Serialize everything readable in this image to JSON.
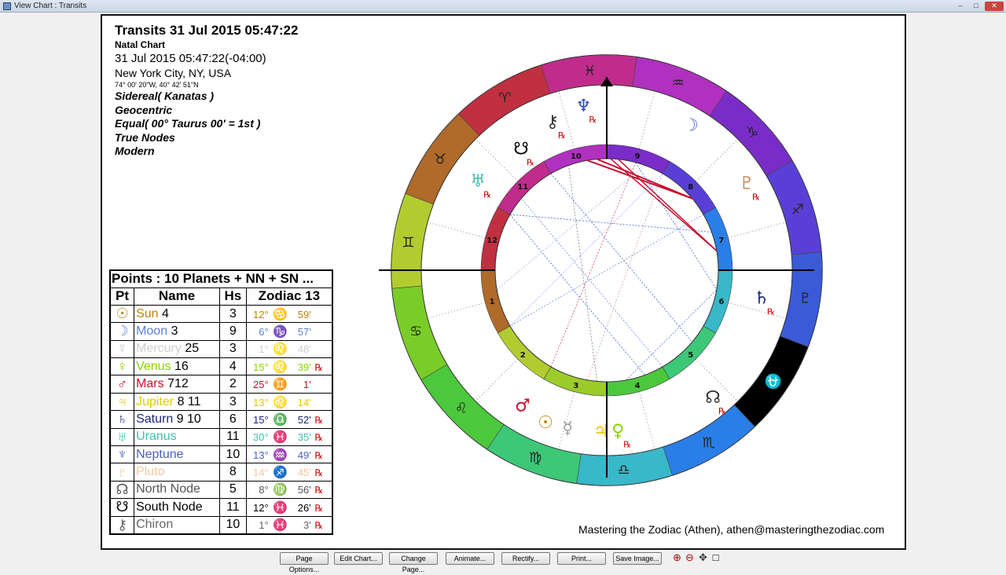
{
  "window": {
    "title": "View Chart : Transits",
    "min": "–",
    "max": "□",
    "close": "✕"
  },
  "header": {
    "title": "Transits 31 Jul 2015 05:47:22",
    "subtitle": "Natal Chart",
    "datetime": "31 Jul 2015 05:47:22(-04:00)",
    "location": "New York City, NY, USA",
    "coords": "74° 00' 20\"W, 40° 42' 51\"N",
    "zodiac": "Sidereal( Kanatas )",
    "centric": "Geocentric",
    "houses": "Equal( 00° Taurus 00' = 1st )",
    "nodes": "True Nodes",
    "style": "Modern"
  },
  "table": {
    "caption": "Points : 10 Planets + NN + SN ...",
    "headers": [
      "Pt",
      "Name",
      "Hs",
      "Zodiac 13"
    ],
    "rows": [
      {
        "glyph": "☉",
        "color": "#b8860b",
        "name": "Sun",
        "extra": "4",
        "house": "3",
        "deg": "12°",
        "sign": "♋",
        "min": "59'",
        "rx": ""
      },
      {
        "glyph": "☽",
        "color": "#5b7fd6",
        "name": "Moon",
        "extra": "3",
        "house": "9",
        "deg": "6°",
        "sign": "♑",
        "min": "57'",
        "rx": ""
      },
      {
        "glyph": "☿",
        "color": "#cfcfcf",
        "name": "Mercury",
        "extra": "25",
        "house": "3",
        "deg": "1°",
        "sign": "♌",
        "min": "48'",
        "rx": ""
      },
      {
        "glyph": "♀",
        "color": "#8bd400",
        "name": "Venus",
        "extra": "16",
        "house": "4",
        "deg": "15°",
        "sign": "♌",
        "min": "39'",
        "rx": "℞"
      },
      {
        "glyph": "♂",
        "color": "#c8102e",
        "name": "Mars",
        "extra": "712",
        "house": "2",
        "deg": "25°",
        "sign": "♊",
        "min": "1'",
        "rx": ""
      },
      {
        "glyph": "♃",
        "color": "#e6c800",
        "name": "Jupiter",
        "extra": "8 11",
        "house": "3",
        "deg": "13°",
        "sign": "♌",
        "min": "14'",
        "rx": ""
      },
      {
        "glyph": "♄",
        "color": "#1a237e",
        "name": "Saturn",
        "extra": "9 10",
        "house": "6",
        "deg": "15°",
        "sign": "♎",
        "min": "52'",
        "rx": "℞"
      },
      {
        "glyph": "♅",
        "color": "#40c0b0",
        "name": "Uranus",
        "extra": "",
        "house": "11",
        "deg": "30°",
        "sign": "♓",
        "min": "35'",
        "rx": "℞"
      },
      {
        "glyph": "♆",
        "color": "#4a5fc1",
        "name": "Neptune",
        "extra": "",
        "house": "10",
        "deg": "13°",
        "sign": "♒",
        "min": "49'",
        "rx": "℞"
      },
      {
        "glyph": "♇",
        "color": "#f0c8a0",
        "name": "Pluto",
        "extra": "",
        "house": "8",
        "deg": "14°",
        "sign": "♐",
        "min": "45'",
        "rx": "℞"
      },
      {
        "glyph": "☊",
        "color": "#555555",
        "name": "North Node",
        "extra": "",
        "house": "5",
        "deg": "8°",
        "sign": "♍",
        "min": "56'",
        "rx": "℞"
      },
      {
        "glyph": "☋",
        "color": "#000000",
        "name": "South Node",
        "extra": "",
        "house": "11",
        "deg": "12°",
        "sign": "♓",
        "min": "26'",
        "rx": "℞"
      },
      {
        "glyph": "⚷",
        "color": "#666666",
        "name": "Chiron",
        "extra": "",
        "house": "10",
        "deg": "1°",
        "sign": "♓",
        "min": "3'",
        "rx": "℞"
      }
    ]
  },
  "chart": {
    "zodiac": [
      {
        "glyph": "♒",
        "color": "#b030c0"
      },
      {
        "glyph": "♑",
        "color": "#7a2cc8"
      },
      {
        "glyph": "♐",
        "color": "#5a3fd6"
      },
      {
        "glyph": "♇",
        "color": "#3a5ad8"
      },
      {
        "glyph": "⛎",
        "color": "#000000"
      },
      {
        "glyph": "♏",
        "color": "#2a7ee8"
      },
      {
        "glyph": "♎",
        "color": "#38b8c8"
      },
      {
        "glyph": "♍",
        "color": "#3dc878"
      },
      {
        "glyph": "♌",
        "color": "#4cc83c"
      },
      {
        "glyph": "♋",
        "color": "#7acc28"
      },
      {
        "glyph": "♊",
        "color": "#b2cc30"
      },
      {
        "glyph": "♉",
        "color": "#b06a2a"
      },
      {
        "glyph": "♈",
        "color": "#c03040"
      },
      {
        "glyph": "♓",
        "color": "#c02c8c"
      }
    ],
    "houses": [
      "1",
      "2",
      "3",
      "4",
      "5",
      "6",
      "7",
      "8",
      "9",
      "10",
      "11",
      "12"
    ],
    "outer_planets": [
      {
        "glyph": "♆",
        "color": "#2f46b8",
        "rx": "℞"
      },
      {
        "glyph": "⚷",
        "color": "#333333",
        "rx": "℞"
      },
      {
        "glyph": "☋",
        "color": "#000000",
        "rx": "℞"
      },
      {
        "glyph": "☽",
        "color": "#4a6fd0",
        "rx": ""
      },
      {
        "glyph": "♇",
        "color": "#c98a55",
        "rx": "℞"
      },
      {
        "glyph": "♄",
        "color": "#1a237e",
        "rx": "℞"
      },
      {
        "glyph": "☊",
        "color": "#333333",
        "rx": "℞"
      },
      {
        "glyph": "♂",
        "color": "#c8102e",
        "rx": ""
      },
      {
        "glyph": "☉",
        "color": "#b8860b",
        "rx": ""
      },
      {
        "glyph": "☿",
        "color": "#999999",
        "rx": ""
      },
      {
        "glyph": "♃",
        "color": "#e6c800",
        "rx": ""
      },
      {
        "glyph": "♀",
        "color": "#8bd400",
        "rx": "℞"
      },
      {
        "glyph": "♅",
        "color": "#40c0b0",
        "rx": "℞"
      }
    ],
    "rx_label": "℞"
  },
  "footer": "Mastering the Zodiac (Athen), athen@masteringthezodiac.com",
  "toolbar": {
    "buttons": [
      "Page Options...",
      "Edit Chart...",
      "Change Page...",
      "Animate...",
      "Rectify...",
      "Print...",
      "Save Image..."
    ],
    "zoom_in": "⊕",
    "zoom_out": "⊖",
    "pan": "✥",
    "fit": "□"
  }
}
